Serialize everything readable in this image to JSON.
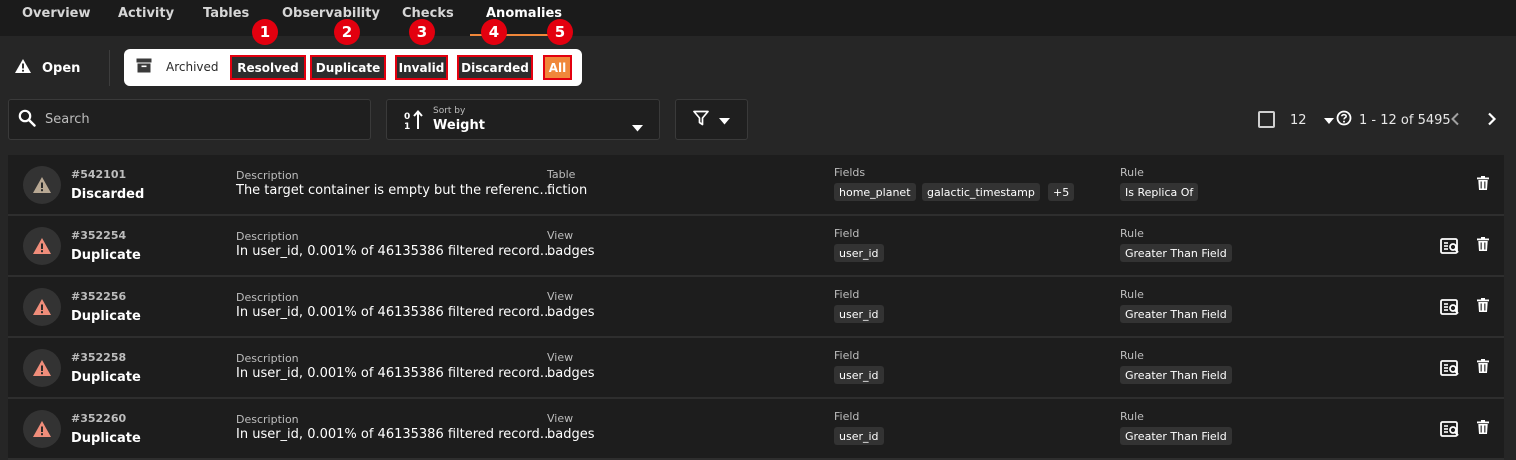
{
  "nav": {
    "tabs": [
      {
        "label": "Overview"
      },
      {
        "label": "Activity"
      },
      {
        "label": "Tables"
      },
      {
        "label": "Observability"
      },
      {
        "label": "Checks"
      },
      {
        "label": "Anomalies"
      }
    ],
    "active_tab": "Anomalies"
  },
  "filters": {
    "open_label": "Open",
    "archived_label": "Archived",
    "statuses": [
      {
        "label": "Resolved",
        "annotation": "1"
      },
      {
        "label": "Duplicate",
        "annotation": "2"
      },
      {
        "label": "Invalid",
        "annotation": "3"
      },
      {
        "label": "Discarded",
        "annotation": "4"
      },
      {
        "label": "All",
        "annotation": "5"
      }
    ]
  },
  "toolbar": {
    "search_placeholder": "Search",
    "sort_label": "Sort by",
    "sort_value": "Weight",
    "page_size": "12",
    "range_text": "1 - 12 of 5495"
  },
  "colors": {
    "highlight_border": "#e3000f",
    "accent": "#f0873a",
    "warning_icon": "#f08d7a",
    "discarded_icon": "#b8a893"
  },
  "anomalies": [
    {
      "id": "#542101",
      "status": "Discarded",
      "icon": "warning-triangle-muted",
      "desc_label": "Description",
      "description": "The target container is empty but the referenc…",
      "target_label": "Table",
      "target": "fiction",
      "fields_label": "Fields",
      "fields": [
        "home_planet",
        "galactic_timestamp",
        "+5"
      ],
      "rule_label": "Rule",
      "rule": "Is Replica Of",
      "has_inspect": false
    },
    {
      "id": "#352254",
      "status": "Duplicate",
      "icon": "warning-triangle",
      "desc_label": "Description",
      "description": "In user_id, 0.001% of 46135386 filtered record…",
      "target_label": "View",
      "target": "badges",
      "fields_label": "Field",
      "fields": [
        "user_id"
      ],
      "rule_label": "Rule",
      "rule": "Greater Than Field",
      "has_inspect": true
    },
    {
      "id": "#352256",
      "status": "Duplicate",
      "icon": "warning-triangle",
      "desc_label": "Description",
      "description": "In user_id, 0.001% of 46135386 filtered record…",
      "target_label": "View",
      "target": "badges",
      "fields_label": "Field",
      "fields": [
        "user_id"
      ],
      "rule_label": "Rule",
      "rule": "Greater Than Field",
      "has_inspect": true
    },
    {
      "id": "#352258",
      "status": "Duplicate",
      "icon": "warning-triangle",
      "desc_label": "Description",
      "description": "In user_id, 0.001% of 46135386 filtered record…",
      "target_label": "View",
      "target": "badges",
      "fields_label": "Field",
      "fields": [
        "user_id"
      ],
      "rule_label": "Rule",
      "rule": "Greater Than Field",
      "has_inspect": true
    },
    {
      "id": "#352260",
      "status": "Duplicate",
      "icon": "warning-triangle",
      "desc_label": "Description",
      "description": "In user_id, 0.001% of 46135386 filtered record…",
      "target_label": "View",
      "target": "badges",
      "fields_label": "Field",
      "fields": [
        "user_id"
      ],
      "rule_label": "Rule",
      "rule": "Greater Than Field",
      "has_inspect": true
    }
  ]
}
